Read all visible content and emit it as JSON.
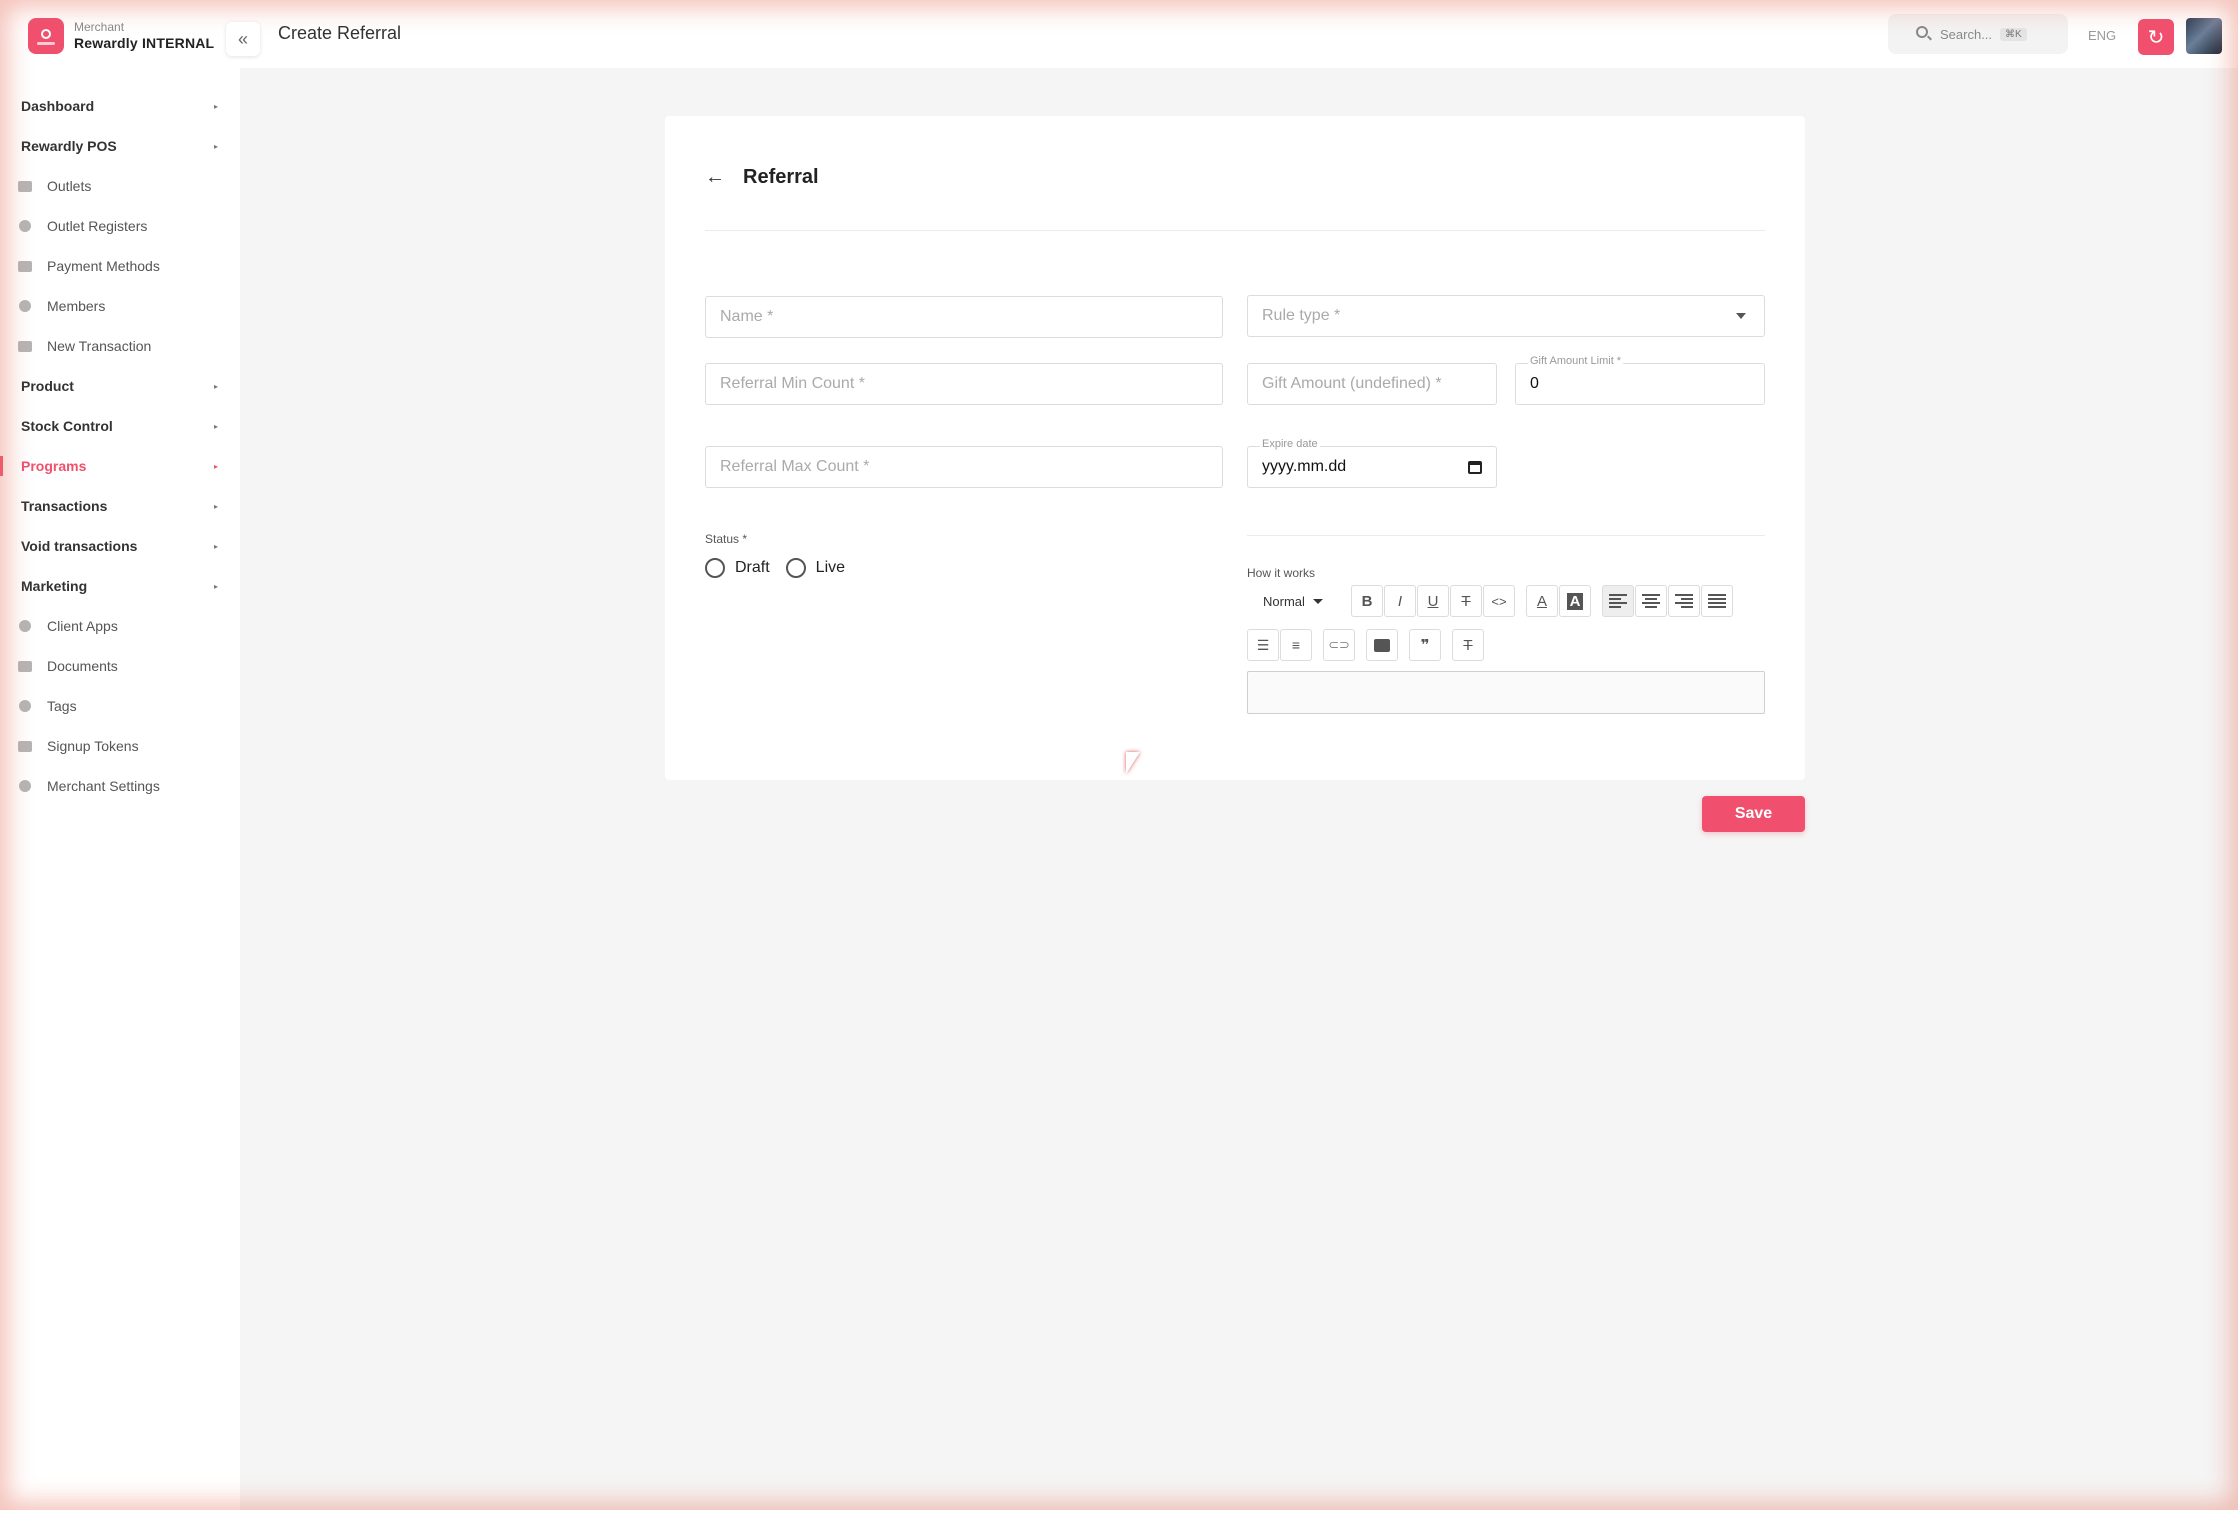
{
  "brand": {
    "subtitle": "Merchant",
    "name": "Rewardly INTERNAL"
  },
  "topbar": {
    "page_title": "Create Referral",
    "search_placeholder": "Search...",
    "search_shortcut": "⌘K",
    "language": "ENG"
  },
  "sidebar": {
    "items": [
      {
        "label": "Dashboard",
        "type": "group",
        "icon": ""
      },
      {
        "label": "Rewardly POS",
        "type": "group",
        "icon": ""
      },
      {
        "label": "Outlets",
        "type": "sub",
        "icon": "store-icon"
      },
      {
        "label": "Outlet Registers",
        "type": "sub",
        "icon": "register-icon"
      },
      {
        "label": "Payment Methods",
        "type": "sub",
        "icon": "payment-icon"
      },
      {
        "label": "Members",
        "type": "sub",
        "icon": "members-icon"
      },
      {
        "label": "New Transaction",
        "type": "sub",
        "icon": "card-icon"
      },
      {
        "label": "Product",
        "type": "group",
        "icon": ""
      },
      {
        "label": "Stock Control",
        "type": "group",
        "icon": ""
      },
      {
        "label": "Programs",
        "type": "group",
        "icon": "",
        "active": true
      },
      {
        "label": "Transactions",
        "type": "group",
        "icon": ""
      },
      {
        "label": "Void transactions",
        "type": "group",
        "icon": ""
      },
      {
        "label": "Marketing",
        "type": "group",
        "icon": ""
      },
      {
        "label": "Client Apps",
        "type": "sub",
        "icon": "code-icon"
      },
      {
        "label": "Documents",
        "type": "sub",
        "icon": "document-icon"
      },
      {
        "label": "Tags",
        "type": "sub",
        "icon": "tag-icon"
      },
      {
        "label": "Signup Tokens",
        "type": "sub",
        "icon": "token-icon"
      },
      {
        "label": "Merchant Settings",
        "type": "sub",
        "icon": "settings-icon"
      }
    ],
    "accent_color": "#f0506e"
  },
  "form": {
    "title": "Referral",
    "name_placeholder": "Name *",
    "rule_type_placeholder": "Rule type *",
    "referral_min_placeholder": "Referral Min Count *",
    "gift_amount_placeholder": "Gift Amount (undefined) *",
    "gift_limit_label": "Gift Amount Limit *",
    "gift_limit_value": "0",
    "referral_max_placeholder": "Referral Max Count *",
    "expire_label": "Expire date",
    "expire_value": "yyyy.mm.dd",
    "status_label": "Status *",
    "status_options": [
      "Draft",
      "Live"
    ],
    "how_it_works_label": "How it works",
    "editor_format": "Normal",
    "save_label": "Save"
  }
}
